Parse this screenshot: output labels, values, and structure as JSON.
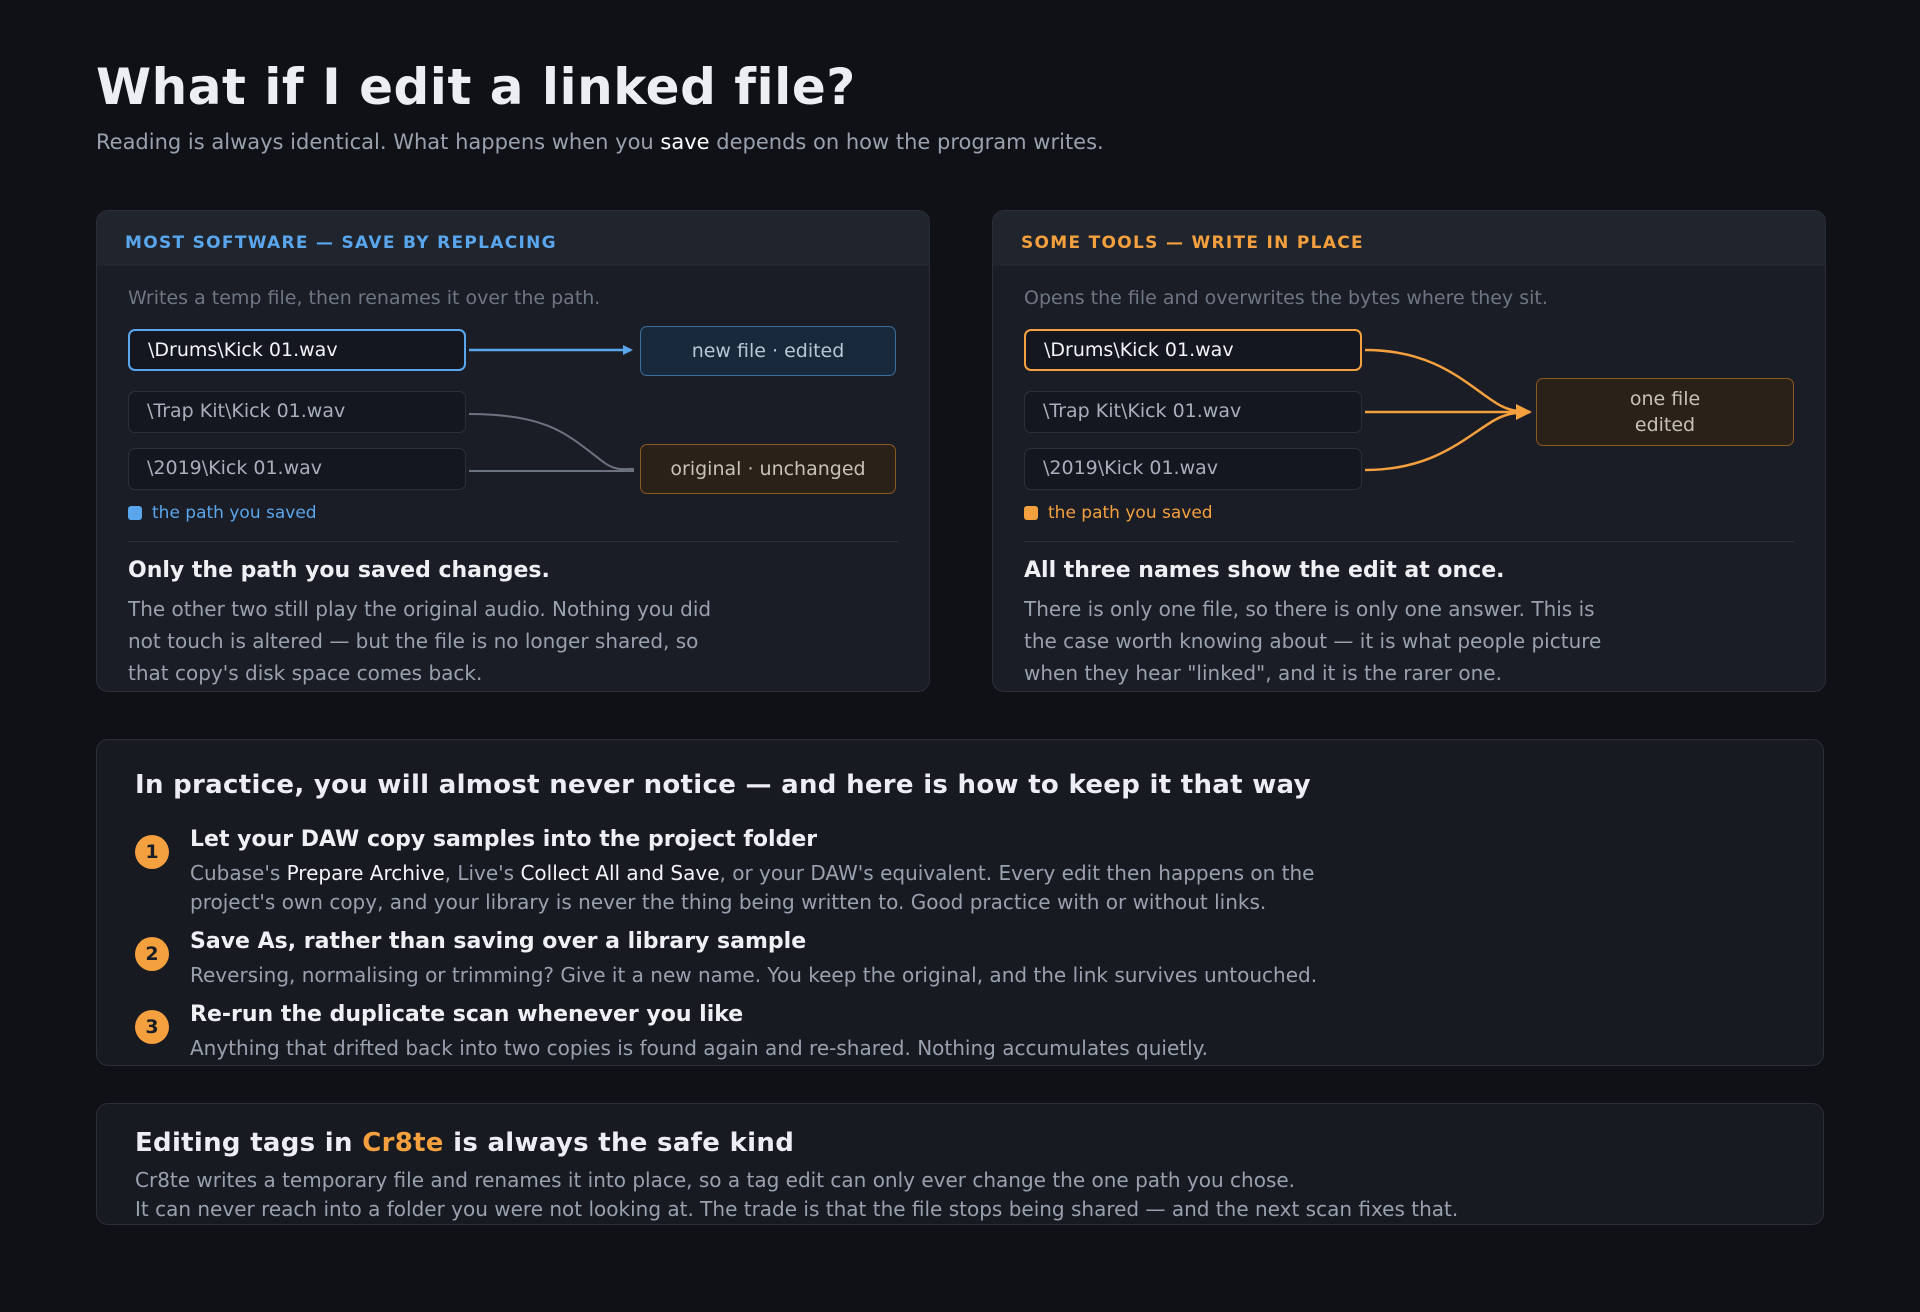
{
  "title": "What if I edit a linked file?",
  "subtitle": {
    "before": "Reading is always identical. What happens when you ",
    "highlight": "save",
    "after": " depends on how the program writes."
  },
  "colors": {
    "accent_blue": "#5aa6ec",
    "accent_orange": "#f5a03e",
    "background": "#0f1116",
    "panel": "#1a1d25"
  },
  "panels": [
    {
      "header": "MOST SOFTWARE — SAVE BY REPLACING",
      "description": "Writes a temp file, then renames it over the path.",
      "paths": [
        "\\Drums\\Kick 01.wav",
        "\\Trap Kit\\Kick 01.wav",
        "\\2019\\Kick 01.wav"
      ],
      "results": [
        "new file · edited",
        "original · unchanged"
      ],
      "legend": "the path you saved",
      "conclusion": "Only the path you saved changes.",
      "body": "The other two still play the original audio. Nothing you did not touch is altered — but the file is no longer shared, so that copy's disk space comes back."
    },
    {
      "header": "SOME TOOLS — WRITE IN PLACE",
      "description": "Opens the file and overwrites the bytes where they sit.",
      "paths": [
        "\\Drums\\Kick 01.wav",
        "\\Trap Kit\\Kick 01.wav",
        "\\2019\\Kick 01.wav"
      ],
      "results": [
        "one file",
        "edited"
      ],
      "legend": "the path you saved",
      "conclusion": "All three names show the edit at once.",
      "body": "There is only one file, so there is only one answer. This is the case worth knowing about — it is what people picture when they hear \"linked\", and it is the rarer one."
    }
  ],
  "practice": {
    "heading": "In practice, you will almost never notice — and here is how to keep it that way",
    "steps": [
      {
        "number": "1",
        "title": "Let your DAW copy samples into the project folder",
        "parts": [
          "Cubase's ",
          "Prepare Archive",
          ", Live's ",
          "Collect All and Save",
          ", or your DAW's equivalent. Every edit then happens on the project's own copy, and your library is never the thing being written to. Good practice with or without links."
        ]
      },
      {
        "number": "2",
        "title": "Save As, rather than saving over a library sample",
        "body": "Reversing, normalising or trimming? Give it a new name. You keep the original, and the link survives untouched."
      },
      {
        "number": "3",
        "title": "Re-run the duplicate scan whenever you like",
        "body": "Anything that drifted back into two copies is found again and re-shared. Nothing accumulates quietly."
      }
    ]
  },
  "editing": {
    "heading_before": "Editing tags in ",
    "brand": "Cr8te",
    "heading_after": " is always the safe kind",
    "line1": "Cr8te writes a temporary file and renames it into place, so a tag edit can only ever change the one path you chose.",
    "line2": "It can never reach into a folder you were not looking at. The trade is that the file stops being shared — and the next scan fixes that."
  }
}
